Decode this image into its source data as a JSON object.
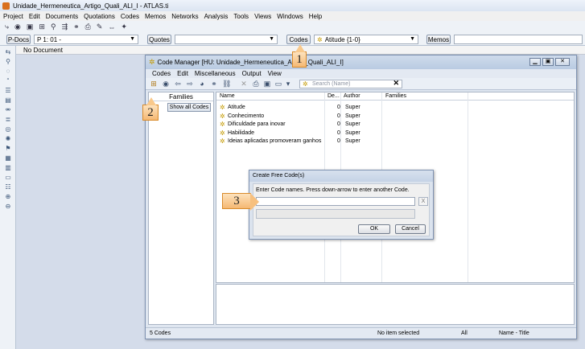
{
  "app": {
    "title": "Unidade_Hermeneutica_Artigo_Quali_ALI_I - ATLAS.ti"
  },
  "menubar": [
    "Project",
    "Edit",
    "Documents",
    "Quotations",
    "Codes",
    "Memos",
    "Networks",
    "Analysis",
    "Tools",
    "Views",
    "Windows",
    "Help"
  ],
  "toolbar2": {
    "pdocs_label": "P-Docs",
    "pdoc_value": "P 1: 01 -",
    "quotes_label": "Quotes",
    "codes_label": "Codes",
    "code_value": "Atitude {1-0}",
    "memos_label": "Memos"
  },
  "doc_header": "No Document",
  "code_manager": {
    "title": "Code Manager [HU: Unidade_Hermeneutica_Artigo_Quali_ALI_I]",
    "menu": [
      "Codes",
      "Edit",
      "Miscellaneous",
      "Output",
      "View"
    ],
    "search_placeholder": "Search (Name)",
    "families_header": "Families",
    "show_all_label": "Show all Codes",
    "columns": [
      "Name",
      "De...",
      "Author",
      "Families"
    ],
    "rows": [
      {
        "name": "Atitude",
        "density": "0",
        "author": "Super"
      },
      {
        "name": "Conhecimento",
        "density": "0",
        "author": "Super"
      },
      {
        "name": "Dificuldade para inovar",
        "density": "0",
        "author": "Super"
      },
      {
        "name": "Habilidade",
        "density": "0",
        "author": "Super"
      },
      {
        "name": "Ideias aplicadas promoveram ganhos",
        "density": "0",
        "author": "Super"
      }
    ],
    "status": {
      "count": "5 Codes",
      "selection": "No item selected",
      "filter": "All",
      "sort": "Name - Title"
    }
  },
  "dialog": {
    "title": "Create Free Code(s)",
    "instruction": "Enter Code names. Press down-arrow to enter another Code.",
    "clear_label": "X",
    "ok_label": "OK",
    "cancel_label": "Cancel"
  },
  "callouts": [
    "1",
    "2",
    "3"
  ]
}
